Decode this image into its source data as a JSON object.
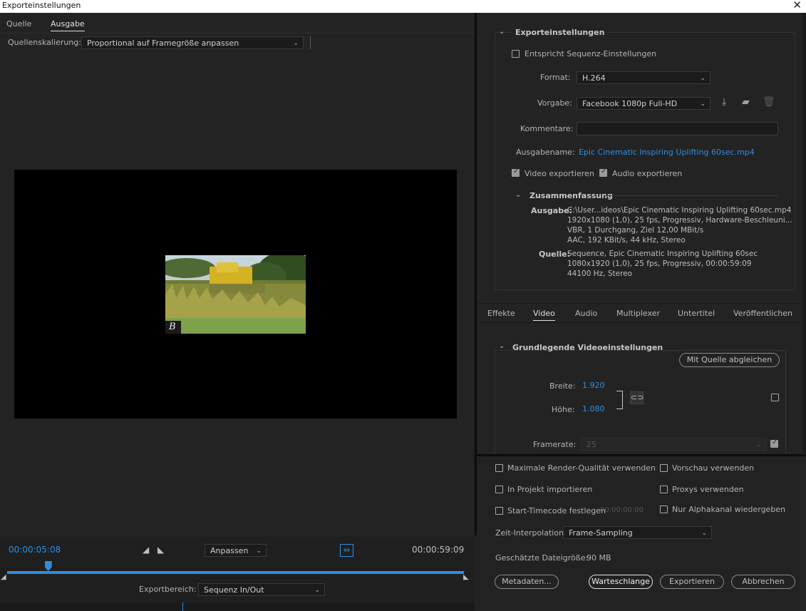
{
  "window": {
    "title": "Exporteinstellungen",
    "close_glyph": "✕"
  },
  "source_tabs": [
    {
      "label": "Quelle"
    },
    {
      "label": "Ausgabe"
    }
  ],
  "scaling": {
    "label": "Quellenskalierung:",
    "value": "Proportional auf Framegröße anpassen"
  },
  "playback": {
    "current_time": "00:00:05:08",
    "end_time": "00:00:59:09",
    "fit_value": "Anpassen",
    "playhead_fraction": 0.09,
    "range_label": "Exportbereich:",
    "range_value": "Sequenz In/Out"
  },
  "export_settings": {
    "heading": "Exporteinstellungen",
    "match_sequence_label": "Entspricht Sequenz-Einstellungen",
    "match_sequence_checked": false,
    "format_label": "Format:",
    "format_value": "H.264",
    "preset_label": "Vorgabe:",
    "preset_value": "Facebook 1080p Full-HD",
    "comments_label": "Kommentare:",
    "comments_value": "",
    "output_name_label": "Ausgabename:",
    "output_name_value": "Epic Cinematic Inspiring Uplifting 60sec.mp4",
    "export_video_label": "Video exportieren",
    "export_video_checked": true,
    "export_audio_label": "Audio exportieren",
    "export_audio_checked": true
  },
  "summary": {
    "heading": "Zusammenfassung",
    "output_label": "Ausgabe:",
    "output_lines": [
      "C:\\User...ideos\\Epic Cinematic Inspiring Uplifting 60sec.mp4",
      "1920x1080 (1,0), 25 fps, Progressiv, Hardware-Beschleuni...",
      "VBR, 1 Durchgang, Ziel 12,00 MBit/s",
      "AAC, 192 KBit/s, 44 kHz, Stereo"
    ],
    "source_label": "Quelle:",
    "source_lines": [
      "Sequence, Epic Cinematic Inspiring Uplifting 60sec",
      "1080x1920 (1,0), 25 fps, Progressiv, 00:00:59:09",
      "44100 Hz, Stereo"
    ]
  },
  "settings_tabs": [
    {
      "label": "Effekte"
    },
    {
      "label": "Video"
    },
    {
      "label": "Audio"
    },
    {
      "label": "Multiplexer"
    },
    {
      "label": "Untertitel"
    },
    {
      "label": "Veröffentlichen"
    }
  ],
  "video_basic": {
    "heading": "Grundlegende Videoeinstellungen",
    "match_source_button": "Mit Quelle abgleichen",
    "width_label": "Breite:",
    "width_value": "1.920",
    "height_label": "Höhe:",
    "height_value": "1.080",
    "framerate_label": "Framerate:",
    "framerate_value": "25"
  },
  "options": {
    "max_render_quality": "Maximale Render-Qualität verwenden",
    "use_previews": "Vorschau verwenden",
    "import_into_project": "In Projekt importieren",
    "use_proxies": "Proxys verwenden",
    "set_start_timecode": "Start-Timecode festlegen",
    "start_timecode_value": "00:00:00:00",
    "render_alpha_only": "Nur Alphakanal wiedergeben",
    "time_interpolation_label": "Zeit-Interpolation:",
    "time_interpolation_value": "Frame-Sampling",
    "estimated_size_label": "Geschätzte Dateigröße:",
    "estimated_size_value": "90 MB"
  },
  "buttons": {
    "metadata": "Metadaten...",
    "queue": "Warteschlange",
    "export": "Exportieren",
    "cancel": "Abbrechen"
  },
  "colors": {
    "accent": "#2f8ee0",
    "panel": "#232323",
    "preview_bg": "#000000"
  },
  "preview_watermark": "B"
}
